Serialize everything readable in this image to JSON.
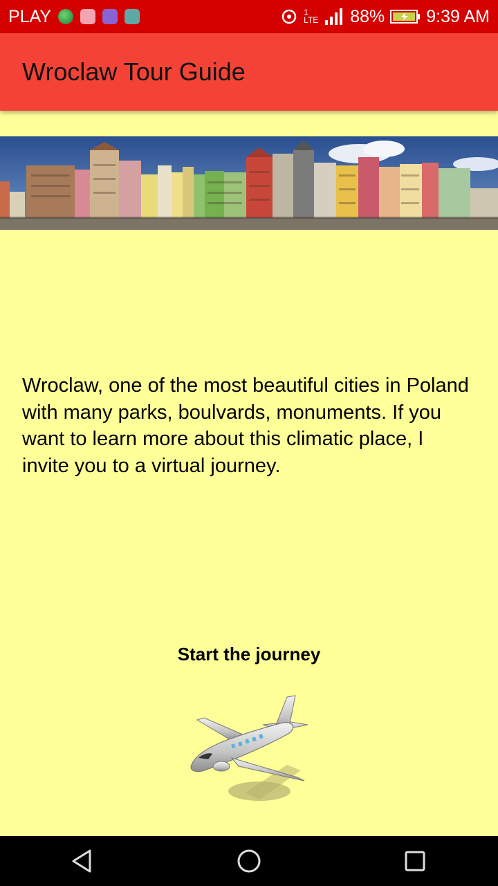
{
  "status_bar": {
    "carrier": "PLAY",
    "network_sup": "1",
    "network_type": "LTE",
    "battery": "88%",
    "time": "9:39 AM",
    "icons": [
      "globe-icon",
      "mail-icon",
      "sync-app-icon",
      "android-icon",
      "hotspot-icon",
      "signal-icon",
      "battery-icon"
    ]
  },
  "app_bar": {
    "title": "Wroclaw Tour Guide"
  },
  "banner": {
    "image_name": "wroclaw-market-square-panorama"
  },
  "content": {
    "description": "Wroclaw, one of the most beautiful cities in Poland with many parks, boulvards, monuments. If you want to learn more about this climatic place, I invite you to a virtual journey.",
    "start_label": "Start the journey",
    "start_icon": "airplane-icon"
  },
  "nav_bar": {
    "icons": [
      "back-icon",
      "home-icon",
      "recents-icon"
    ]
  },
  "colors": {
    "status_bar": "#d50000",
    "app_bar": "#f44336",
    "background": "#ffff99",
    "nav_bar": "#000000"
  }
}
